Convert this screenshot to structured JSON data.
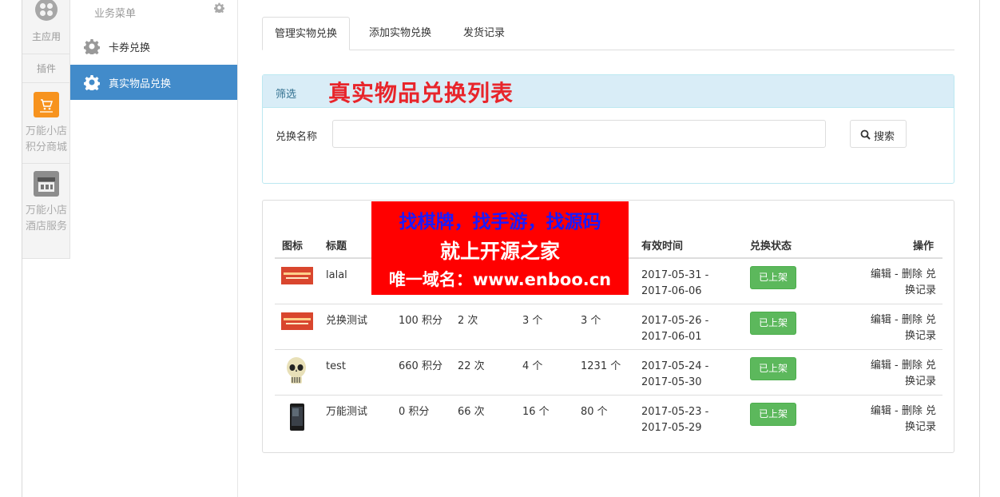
{
  "rail": {
    "main_app_label": "主应用",
    "plugin_label": "插件",
    "shop_mall_label": "万能小店积分商城",
    "shop_mall_lines": [
      "万能小店",
      "积分商城"
    ],
    "hotel_service_lines": [
      "万能小店",
      "酒店服务"
    ],
    "shop_mall_icon_color": "#f7931e",
    "hotel_icon_color": "#8d8d8d"
  },
  "menu": {
    "header": "业务菜单",
    "items": [
      {
        "label": "卡券兑换",
        "icon": "gear-icon",
        "active": false
      },
      {
        "label": "真实物品兑换",
        "icon": "gear-icon",
        "active": true
      }
    ]
  },
  "tabs": [
    {
      "label": "管理实物兑换",
      "active": true
    },
    {
      "label": "添加实物兑换",
      "active": false
    },
    {
      "label": "发货记录",
      "active": false
    }
  ],
  "filter": {
    "heading": "筛选",
    "overlay_title": "真实物品兑换列表",
    "field_label": "兑换名称",
    "field_value": "",
    "search_label": "搜索"
  },
  "table": {
    "headers": [
      "图标",
      "标题",
      "",
      "",
      "",
      "",
      "有效时间",
      "兑换状态",
      "操作"
    ],
    "rows": [
      {
        "thumb": "banner",
        "title": "lalal",
        "points": "",
        "times": "",
        "per": "",
        "stock": "",
        "time_start": "2017-05-31 -",
        "time_end": "2017-06-06",
        "status": "已上架",
        "op_line1": "编辑 -  删除 兑",
        "op_line2": "换记录"
      },
      {
        "thumb": "banner",
        "title": "兑换测试",
        "points": "100 积分",
        "times": "2 次",
        "per": "3 个",
        "stock": "3 个",
        "time_start": "2017-05-26 -",
        "time_end": "2017-06-01",
        "status": "已上架",
        "op_line1": "编辑 -  删除 兑",
        "op_line2": "换记录"
      },
      {
        "thumb": "skull",
        "title": "test",
        "points": "660 积分",
        "times": "22 次",
        "per": "4 个",
        "stock": "1231 个",
        "time_start": "2017-05-24 -",
        "time_end": "2017-05-30",
        "status": "已上架",
        "op_line1": "编辑 -  删除 兑",
        "op_line2": "换记录"
      },
      {
        "thumb": "phone",
        "title": "万能测试",
        "points": "0 积分",
        "times": "66 次",
        "per": "16 个",
        "stock": "80 个",
        "time_start": "2017-05-23 -",
        "time_end": "2017-05-29",
        "status": "已上架",
        "op_line1": "编辑 -  删除 兑",
        "op_line2": "换记录"
      }
    ]
  },
  "ad": {
    "line1": "找棋牌，找手游，找源码",
    "line2": "就上开源之家",
    "line3": "唯一域名：www.enboo.cn"
  },
  "colors": {
    "active_menu": "#428bca",
    "status_green": "#5cb85c",
    "filter_heading_bg": "#d9edf7",
    "overlay_red": "#e8252b",
    "ad_bg": "#ff0000",
    "ad_blue": "#1a1aff"
  }
}
